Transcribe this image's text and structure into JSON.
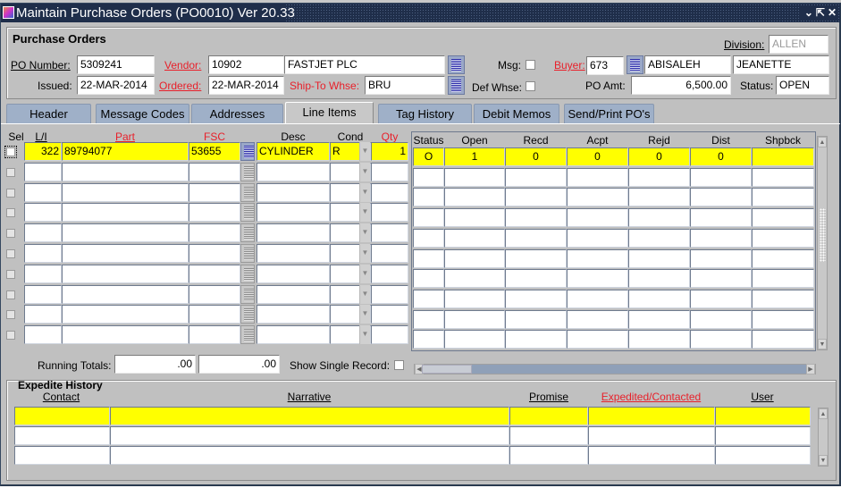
{
  "window": {
    "title": "Maintain Purchase Orders (PO0010) Ver 20.33",
    "controls": {
      "minimize": "⌄",
      "restore": "⇱",
      "close": "✕"
    }
  },
  "po_header": {
    "section_title": "Purchase Orders",
    "division_label": "Division:",
    "division_value": "ALLEN",
    "po_number_label": "PO Number:",
    "po_number_value": "5309241",
    "vendor_label": "Vendor:",
    "vendor_code": "10902",
    "vendor_name": "FASTJET PLC",
    "msg_label": "Msg:",
    "buyer_label": "Buyer:",
    "buyer_code": "673",
    "buyer_last_name": "ABISALEH",
    "buyer_first_name": "JEANETTE",
    "issued_label": "Issued:",
    "issued_value": "22-MAR-2014",
    "ordered_label": "Ordered:",
    "ordered_value": "22-MAR-2014",
    "ship_to_label": "Ship-To Whse:",
    "ship_to_value": "BRU",
    "def_whse_label": "Def Whse:",
    "po_amt_label": "PO Amt:",
    "po_amt_value": "6,500.00",
    "status_label": "Status:",
    "status_value": "OPEN"
  },
  "tabs": [
    {
      "label": "Header",
      "active": false
    },
    {
      "label": "Message Codes",
      "active": false
    },
    {
      "label": "Addresses",
      "active": false
    },
    {
      "label": "Line Items",
      "active": true
    },
    {
      "label": "Tag History",
      "active": false
    },
    {
      "label": "Debit Memos",
      "active": false
    },
    {
      "label": "Send/Print PO's",
      "active": false
    }
  ],
  "line_items": {
    "headers": {
      "sel": "Sel",
      "li": "L/I",
      "part": "Part",
      "fsc": "FSC",
      "desc": "Desc",
      "cond": "Cond",
      "qty": "Qty"
    },
    "rows": [
      {
        "li": "322",
        "part": "89794077",
        "fsc": "53655",
        "desc": "CYLINDER",
        "cond": "R",
        "qty": "1"
      },
      {
        "li": "",
        "part": "",
        "fsc": "",
        "desc": "",
        "cond": "",
        "qty": ""
      },
      {
        "li": "",
        "part": "",
        "fsc": "",
        "desc": "",
        "cond": "",
        "qty": ""
      },
      {
        "li": "",
        "part": "",
        "fsc": "",
        "desc": "",
        "cond": "",
        "qty": ""
      },
      {
        "li": "",
        "part": "",
        "fsc": "",
        "desc": "",
        "cond": "",
        "qty": ""
      },
      {
        "li": "",
        "part": "",
        "fsc": "",
        "desc": "",
        "cond": "",
        "qty": ""
      },
      {
        "li": "",
        "part": "",
        "fsc": "",
        "desc": "",
        "cond": "",
        "qty": ""
      },
      {
        "li": "",
        "part": "",
        "fsc": "",
        "desc": "",
        "cond": "",
        "qty": ""
      },
      {
        "li": "",
        "part": "",
        "fsc": "",
        "desc": "",
        "cond": "",
        "qty": ""
      },
      {
        "li": "",
        "part": "",
        "fsc": "",
        "desc": "",
        "cond": "",
        "qty": ""
      }
    ],
    "status_headers": [
      "Status",
      "Open",
      "Recd",
      "Acpt",
      "Rejd",
      "Dist",
      "Shpbck"
    ],
    "status_rows": [
      [
        "O",
        "1",
        "0",
        "0",
        "0",
        "0",
        ""
      ],
      [
        "",
        "",
        "",
        "",
        "",
        "",
        ""
      ],
      [
        "",
        "",
        "",
        "",
        "",
        "",
        ""
      ],
      [
        "",
        "",
        "",
        "",
        "",
        "",
        ""
      ],
      [
        "",
        "",
        "",
        "",
        "",
        "",
        ""
      ],
      [
        "",
        "",
        "",
        "",
        "",
        "",
        ""
      ],
      [
        "",
        "",
        "",
        "",
        "",
        "",
        ""
      ],
      [
        "",
        "",
        "",
        "",
        "",
        "",
        ""
      ],
      [
        "",
        "",
        "",
        "",
        "",
        "",
        ""
      ],
      [
        "",
        "",
        "",
        "",
        "",
        "",
        ""
      ]
    ],
    "running_totals_label": "Running Totals:",
    "running_total_1": ".00",
    "running_total_2": ".00",
    "show_single_record_label": "Show Single Record:"
  },
  "expedite_history": {
    "title": "Expedite History",
    "headers": {
      "contact": "Contact",
      "narrative": "Narrative",
      "promise": "Promise",
      "expedited": "Expedited/Contacted",
      "user": "User"
    },
    "rows": [
      {
        "contact": "",
        "narrative": "",
        "promise": "",
        "expedited": "",
        "user": ""
      },
      {
        "contact": "",
        "narrative": "",
        "promise": "",
        "expedited": "",
        "user": ""
      },
      {
        "contact": "",
        "narrative": "",
        "promise": "",
        "expedited": "",
        "user": ""
      }
    ]
  },
  "colors": {
    "current_record": "#ffff00",
    "required_label": "#e8202a",
    "titlebar": "#1f2e4a",
    "tab_inactive": "#9fb0c8"
  }
}
